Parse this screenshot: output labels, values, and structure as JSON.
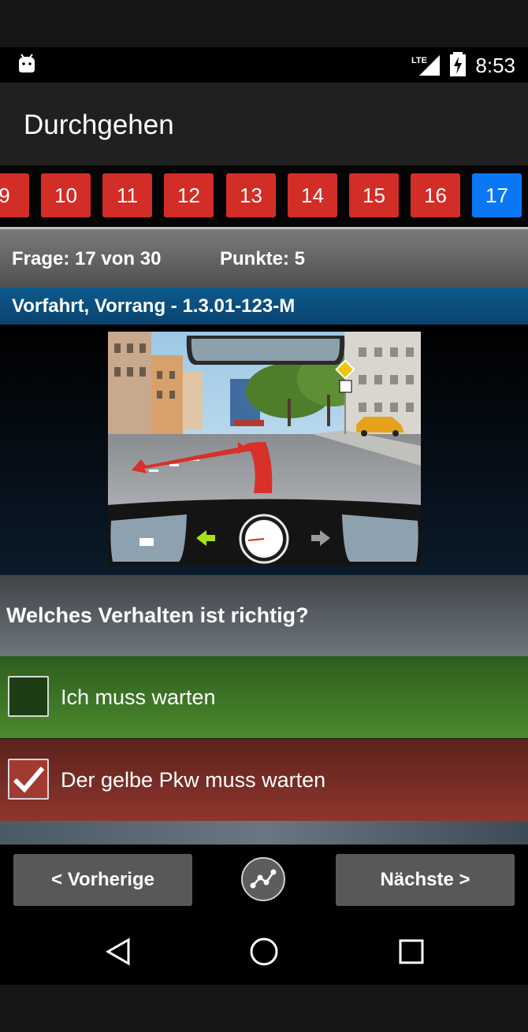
{
  "status": {
    "time": "8:53",
    "network": "LTE"
  },
  "app": {
    "title": "Durchgehen"
  },
  "questions": {
    "numbers": [
      "9",
      "10",
      "11",
      "12",
      "13",
      "14",
      "15",
      "16",
      "17"
    ],
    "current": "17"
  },
  "info": {
    "question_counter": "Frage: 17 von 30",
    "points": "Punkte: 5"
  },
  "category": "Vorfahrt, Vorrang - 1.3.01-123-M",
  "question": "Welches Verhalten ist richtig?",
  "answers": [
    {
      "text": "Ich muss warten",
      "checked": false
    },
    {
      "text": "Der gelbe Pkw muss warten",
      "checked": true
    }
  ],
  "nav": {
    "previous": "< Vorherige",
    "next": "Nächste >"
  },
  "colors": {
    "number_default": "#d22d27",
    "number_current": "#0a78f5",
    "correct": "#3f7a28",
    "wrong": "#7b2c25",
    "category_bar": "#0d5a8c"
  }
}
